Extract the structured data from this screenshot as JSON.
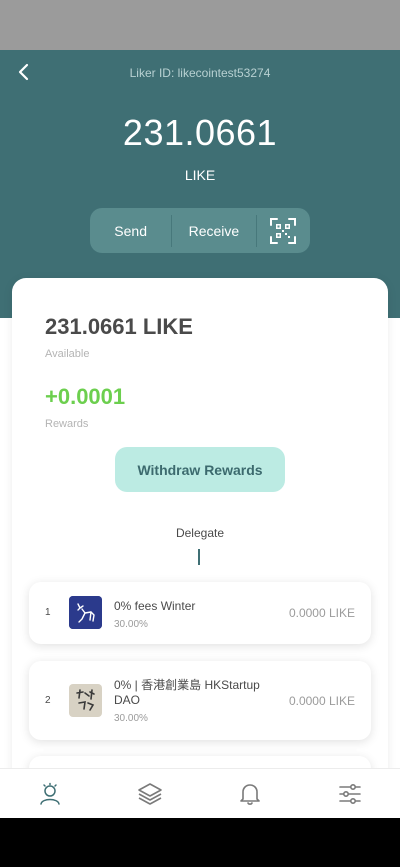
{
  "header": {
    "liker_id": "Liker ID: likecointest53274",
    "balance": "231.0661",
    "unit": "LIKE",
    "actions": {
      "send": "Send",
      "receive": "Receive"
    }
  },
  "card": {
    "available_amount": "231.0661 LIKE",
    "available_label": "Available",
    "rewards_amount": "+0.0001",
    "rewards_label": "Rewards",
    "withdraw_label": "Withdraw Rewards",
    "delegate_label": "Delegate",
    "validators": [
      {
        "index": "1",
        "name": "0% fees Winter",
        "commission": "30.00%",
        "amount": "0.0000 LIKE",
        "avatar_icon": "deer-logo-icon"
      },
      {
        "index": "2",
        "name": "0% | 香港創業島 HKStartup DAO",
        "commission": "30.00%",
        "amount": "0.0000 LIKE",
        "avatar_icon": "calligraphy-logo-icon"
      }
    ]
  },
  "bottom_nav": {
    "icons": [
      "person-icon",
      "layers-icon",
      "bell-icon",
      "sliders-icon"
    ]
  },
  "colors": {
    "header_bg": "#3f6f74",
    "action_bar_bg": "#5a8c8e",
    "rewards_green": "#6ccf4e",
    "withdraw_bg": "#bcebe3"
  }
}
